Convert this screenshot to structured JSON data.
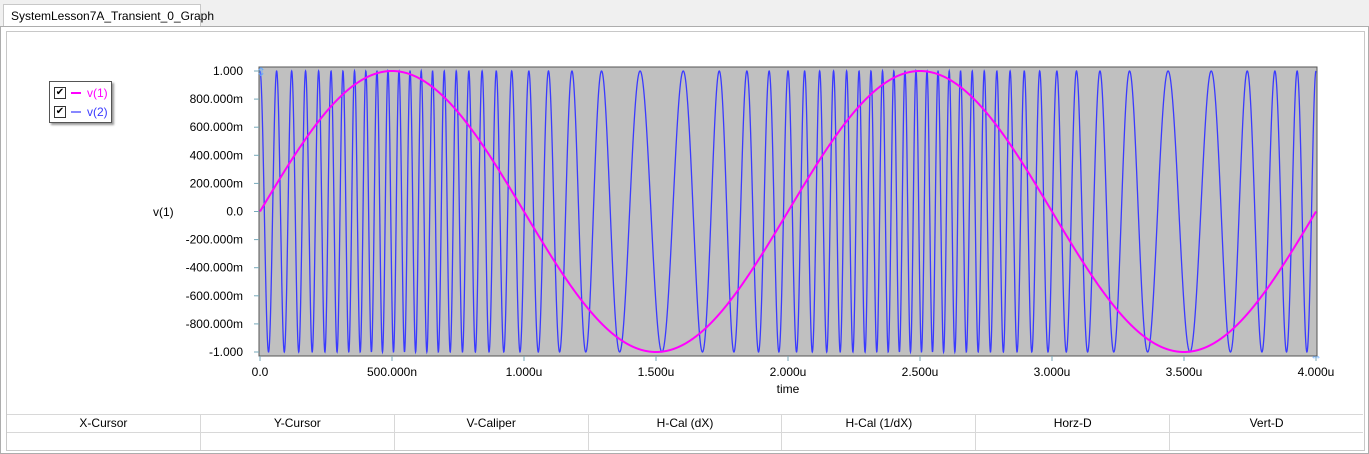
{
  "tab": {
    "title": "SystemLesson7A_Transient_0_Graph"
  },
  "legend": [
    {
      "label": "v(1)",
      "color": "#ff00ff",
      "checked": true
    },
    {
      "label": "v(2)",
      "color": "#3a3aff",
      "checked": true
    }
  ],
  "cursor_table": {
    "headers": [
      "X-Cursor",
      "Y-Cursor",
      "V-Caliper",
      "H-Cal (dX)",
      "H-Cal (1/dX)",
      "Horz-D",
      "Vert-D"
    ],
    "values": [
      "",
      "",
      "",
      "",
      "",
      "",
      ""
    ]
  },
  "chart_data": {
    "type": "line",
    "xlabel": "time",
    "ylabel": "v(1)",
    "xlim": [
      0,
      4e-06
    ],
    "ylim": [
      -1,
      1
    ],
    "x_ticks": [
      0,
      5e-07,
      1e-06,
      1.5e-06,
      2e-06,
      2.5e-06,
      3e-06,
      3.5e-06,
      4e-06
    ],
    "x_tick_labels": [
      "0.0",
      "500.000n",
      "1.000u",
      "1.500u",
      "2.000u",
      "2.500u",
      "3.000u",
      "3.500u",
      "4.000u"
    ],
    "y_ticks": [
      1,
      0.8,
      0.6,
      0.4,
      0.2,
      0,
      -0.2,
      -0.4,
      -0.6,
      -0.8,
      -1
    ],
    "y_tick_labels": [
      "1.000",
      "800.000m",
      "600.000m",
      "400.000m",
      "200.000m",
      "0.0",
      "-200.000m",
      "-400.000m",
      "-600.000m",
      "-800.000m",
      "-1.000"
    ],
    "background": "#c0c0c0",
    "series": [
      {
        "name": "v(1)",
        "color": "#ff00ff",
        "kind": "sine",
        "amplitude": 1,
        "frequency_hz": 500000
      },
      {
        "name": "v(2)",
        "color": "#3a3aff",
        "kind": "fm",
        "amplitude": 1,
        "carrier_hz": 15000000,
        "deviation_hz": 9000000,
        "modulation_hz": 500000
      }
    ]
  }
}
